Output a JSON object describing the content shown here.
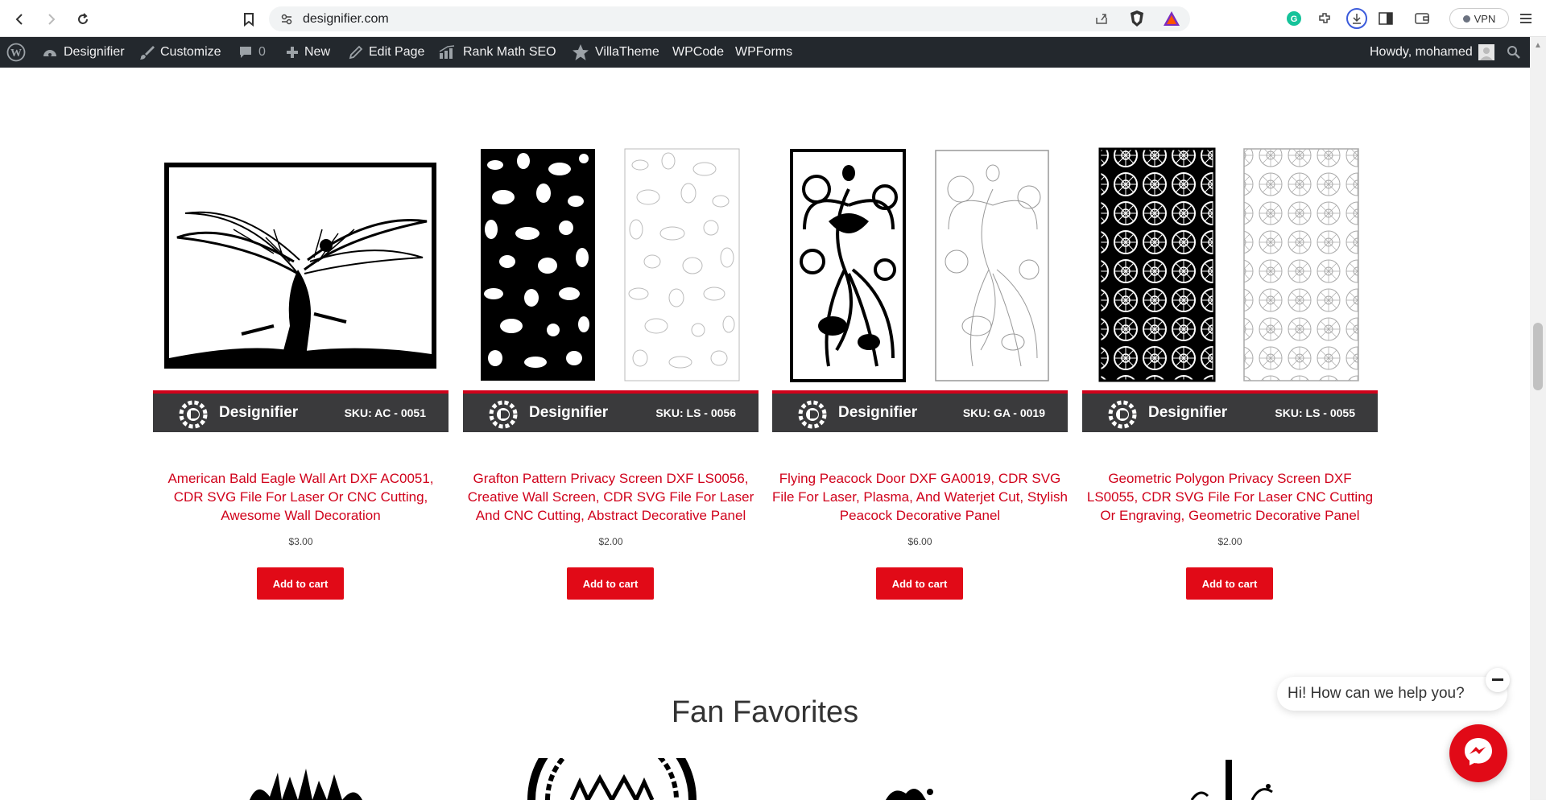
{
  "browser": {
    "url": "designifier.com",
    "vpn_label": "VPN"
  },
  "admin_bar": {
    "site_name": "Designifier",
    "customize": "Customize",
    "comments_count": "0",
    "new": "New",
    "edit_page": "Edit Page",
    "rank_math": "Rank Math SEO",
    "villatheme": "VillaTheme",
    "wpcode": "WPCode",
    "wpforms": "WPForms",
    "howdy": "Howdy, mohamed"
  },
  "products": [
    {
      "brand": "Designifier",
      "sku": "SKU: AC - 0051",
      "title": "American Bald Eagle Wall Art DXF AC0051, CDR SVG File For Laser Or CNC Cutting, Awesome Wall Decoration",
      "price": "$3.00",
      "button": "Add to cart"
    },
    {
      "brand": "Designifier",
      "sku": "SKU: LS - 0056",
      "title": "Grafton Pattern Privacy Screen DXF LS0056, Creative Wall Screen, CDR SVG File For Laser And CNC Cutting, Abstract Decorative Panel",
      "price": "$2.00",
      "button": "Add to cart"
    },
    {
      "brand": "Designifier",
      "sku": "SKU: GA - 0019",
      "title": "Flying Peacock Door DXF GA0019, CDR SVG File For Laser, Plasma, And Waterjet Cut, Stylish Peacock Decorative Panel",
      "price": "$6.00",
      "button": "Add to cart"
    },
    {
      "brand": "Designifier",
      "sku": "SKU: LS - 0055",
      "title": "Geometric Polygon Privacy Screen DXF LS0055, CDR SVG File For Laser CNC Cutting Or Engraving, Geometric Decorative Panel",
      "price": "$2.00",
      "button": "Add to cart"
    }
  ],
  "section": {
    "title": "Fan Favorites"
  },
  "chat": {
    "greeting": "Hi! How can we help you?"
  },
  "colors": {
    "accent": "#e10a17",
    "title_red": "#d0021b",
    "admin_bar": "#23282d",
    "brand_bar": "#3a3a3c"
  }
}
